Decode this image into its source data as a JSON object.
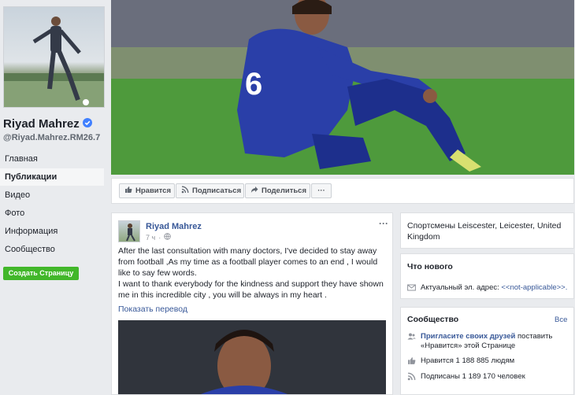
{
  "profile": {
    "name": "Riyad Mahrez",
    "handle": "@Riyad.Mahrez.RM26.7",
    "verified_color": "#4080ff"
  },
  "nav": {
    "items": [
      {
        "label": "Главная"
      },
      {
        "label": "Публикации"
      },
      {
        "label": "Видео"
      },
      {
        "label": "Фото"
      },
      {
        "label": "Информация"
      },
      {
        "label": "Сообщество"
      }
    ],
    "active_index": 1,
    "create_page": "Создать Страницу"
  },
  "actions": {
    "like": "Нравится",
    "subscribe": "Подписаться",
    "share": "Поделиться",
    "more": "···"
  },
  "post": {
    "author": "Riyad Mahrez",
    "time": "7 ч",
    "menu": "···",
    "text_lines": [
      "After the last consultation with many doctors, I've decided to stay away",
      "from football ,As my time as a football player comes to an end , I would",
      "like to say few words.",
      "I want to thank everybody for the kindness and support they have shown",
      "me in this incredible city , you will be always in my heart ."
    ],
    "translate": "Показать перевод"
  },
  "about": {
    "line1": "Спортсмены Leiscester, Leicester, United",
    "line2": "Kingdom"
  },
  "whats_new": {
    "title": "Что нового",
    "email_label": "Актуальный эл. адрес: ",
    "email_value": "<<not-applicable>>."
  },
  "community": {
    "title": "Сообщество",
    "all_link": "Все",
    "invite_link": "Пригласите своих друзей",
    "invite_rest1": " поставить",
    "invite_rest2": "«Нравится» этой Странице",
    "likes": "Нравится 1 188 885 людям",
    "followers": "Подписаны 1 189 170 человек"
  },
  "colors": {
    "accent": "#385898",
    "create_button": "#42b72a",
    "background": "#e9ebee"
  }
}
